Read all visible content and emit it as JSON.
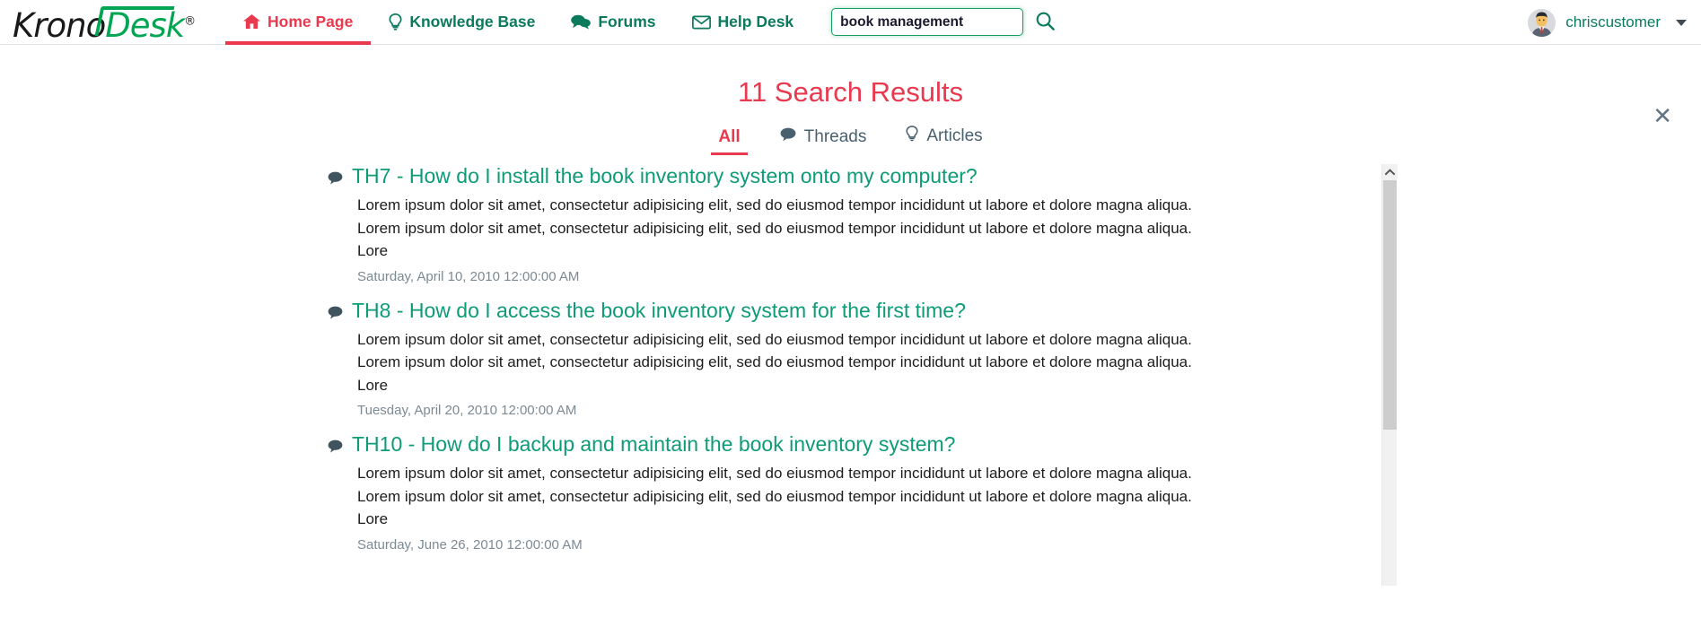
{
  "brand": {
    "name_part1": "Krono",
    "name_part2": "Desk",
    "registered_mark": "®"
  },
  "nav": {
    "items": [
      {
        "label": "Home Page",
        "icon": "home-icon",
        "active": true
      },
      {
        "label": "Knowledge Base",
        "icon": "lightbulb-icon",
        "active": false
      },
      {
        "label": "Forums",
        "icon": "comments-icon",
        "active": false
      },
      {
        "label": "Help Desk",
        "icon": "envelope-icon",
        "active": false
      }
    ],
    "active_color": "#e8394f",
    "link_color": "#0b7a5d"
  },
  "search": {
    "value": "book management",
    "placeholder": "",
    "icon": "search-icon"
  },
  "user": {
    "name": "chriscustomer",
    "avatar_icon": "user-avatar",
    "dropdown_icon": "caret-down-icon"
  },
  "panel": {
    "title": "11 Search Results",
    "close_label": "✕",
    "tabs": [
      {
        "label": "All",
        "icon": null,
        "active": true
      },
      {
        "label": "Threads",
        "icon": "comment-icon",
        "active": false
      },
      {
        "label": "Articles",
        "icon": "lightbulb-icon",
        "active": false
      }
    ]
  },
  "results": [
    {
      "icon": "comment-icon",
      "title": "TH7 - How do I install the book inventory system onto my computer?",
      "snippet_line1": "Lorem ipsum dolor sit amet, consectetur adipisicing elit, sed do eiusmod tempor incididunt ut labore et dolore magna aliqua.",
      "snippet_line2": "Lorem ipsum dolor sit amet, consectetur adipisicing elit, sed do eiusmod tempor incididunt ut labore et dolore magna aliqua.",
      "snippet_line3": "Lore",
      "date": "Saturday, April 10, 2010 12:00:00 AM"
    },
    {
      "icon": "comment-icon",
      "title": "TH8 - How do I access the book inventory system for the first time?",
      "snippet_line1": "Lorem ipsum dolor sit amet, consectetur adipisicing elit, sed do eiusmod tempor incididunt ut labore et dolore magna aliqua.",
      "snippet_line2": "Lorem ipsum dolor sit amet, consectetur adipisicing elit, sed do eiusmod tempor incididunt ut labore et dolore magna aliqua.",
      "snippet_line3": "Lore",
      "date": "Tuesday, April 20, 2010 12:00:00 AM"
    },
    {
      "icon": "comment-icon",
      "title": "TH10 - How do I backup and maintain the book inventory system?",
      "snippet_line1": "Lorem ipsum dolor sit amet, consectetur adipisicing elit, sed do eiusmod tempor incididunt ut labore et dolore magna aliqua.",
      "snippet_line2": "Lorem ipsum dolor sit amet, consectetur adipisicing elit, sed do eiusmod tempor incididunt ut labore et dolore magna aliqua.",
      "snippet_line3": "Lore",
      "date": "Saturday, June 26, 2010 12:00:00 AM"
    }
  ],
  "scrollbar": {
    "up_arrow_icon": "chevron-up-icon"
  }
}
